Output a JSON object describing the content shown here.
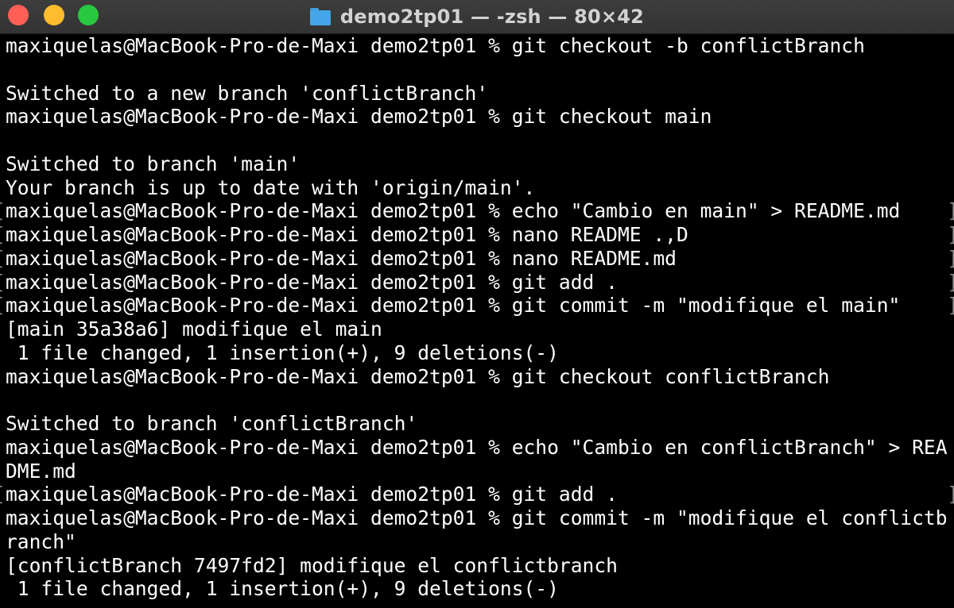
{
  "window": {
    "title": "demo2tp01 — -zsh — 80×42",
    "title_icon": "folder-icon",
    "buttons": {
      "close_color": "#ff5f57",
      "minimize_color": "#febc2e",
      "zoom_color": "#28c840"
    }
  },
  "terminal": {
    "lines": [
      "maxiquelas@MacBook-Pro-de-Maxi demo2tp01 % git checkout -b conflictBranch",
      "",
      "Switched to a new branch 'conflictBranch'",
      "maxiquelas@MacBook-Pro-de-Maxi demo2tp01 % git checkout main",
      "",
      "Switched to branch 'main'",
      "Your branch is up to date with 'origin/main'.",
      "maxiquelas@MacBook-Pro-de-Maxi demo2tp01 % echo \"Cambio en main\" > README.md",
      "maxiquelas@MacBook-Pro-de-Maxi demo2tp01 % nano README .,D",
      "maxiquelas@MacBook-Pro-de-Maxi demo2tp01 % nano README.md",
      "maxiquelas@MacBook-Pro-de-Maxi demo2tp01 % git add .",
      "maxiquelas@MacBook-Pro-de-Maxi demo2tp01 % git commit -m \"modifique el main\"",
      "[main 35a38a6] modifique el main",
      " 1 file changed, 1 insertion(+), 9 deletions(-)",
      "maxiquelas@MacBook-Pro-de-Maxi demo2tp01 % git checkout conflictBranch",
      "",
      "Switched to branch 'conflictBranch'",
      "maxiquelas@MacBook-Pro-de-Maxi demo2tp01 % echo \"Cambio en conflictBranch\" > REA",
      "DME.md",
      "maxiquelas@MacBook-Pro-de-Maxi demo2tp01 % git add .",
      "maxiquelas@MacBook-Pro-de-Maxi demo2tp01 % git commit -m \"modifique el conflictb",
      "ranch\"",
      "[conflictBranch 7497fd2] modifique el conflictbranch",
      " 1 file changed, 1 insertion(+), 9 deletions(-)"
    ]
  }
}
